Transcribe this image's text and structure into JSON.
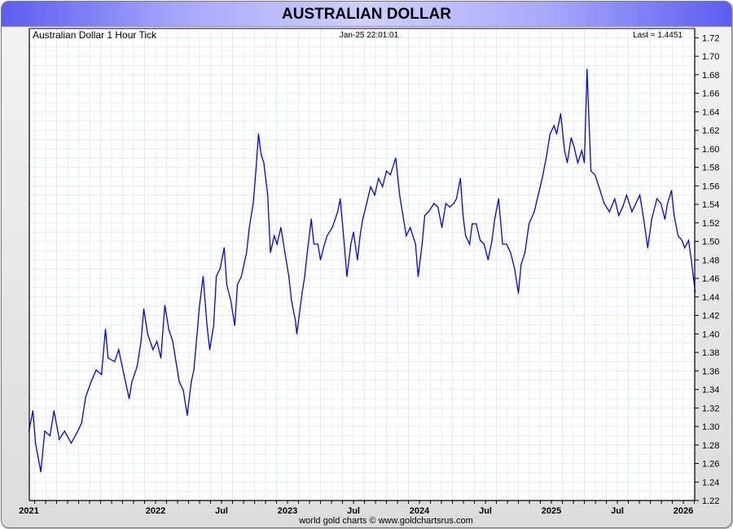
{
  "header": {
    "title": "AUSTRALIAN DOLLAR"
  },
  "chart_data": {
    "type": "line",
    "title": "Australian Dollar 1 Hour Tick",
    "timestamp": "Jan-25  22:01:01",
    "last_label": "Last = 1.4451",
    "footer": "world gold charts © www.goldchartsrus.com",
    "series_color": "#0000ff",
    "xlim": [
      2021.0,
      2026.1
    ],
    "ylim": [
      1.22,
      1.73
    ],
    "y_ticks": [
      "1.22",
      "1.24",
      "1.26",
      "1.28",
      "1.30",
      "1.32",
      "1.34",
      "1.36",
      "1.38",
      "1.40",
      "1.42",
      "1.44",
      "1.46",
      "1.48",
      "1.50",
      "1.52",
      "1.54",
      "1.56",
      "1.58",
      "1.60",
      "1.62",
      "1.64",
      "1.66",
      "1.68",
      "1.70",
      "1.72"
    ],
    "x_ticks": [
      {
        "label": "2021",
        "t": 2021.04
      },
      {
        "label": "2022",
        "t": 2022.0
      },
      {
        "label": "Jul",
        "t": 2022.5
      },
      {
        "label": "2023",
        "t": 2023.0
      },
      {
        "label": "Jul",
        "t": 2023.5
      },
      {
        "label": "2024",
        "t": 2024.0
      },
      {
        "label": "Jul",
        "t": 2024.5
      },
      {
        "label": "2025",
        "t": 2025.0
      },
      {
        "label": "Jul",
        "t": 2025.5
      },
      {
        "label": "2026",
        "t": 2026.0
      }
    ],
    "grid": true,
    "x": [
      2021.04,
      2021.07,
      2021.09,
      2021.13,
      2021.16,
      2021.2,
      2021.23,
      2021.27,
      2021.31,
      2021.36,
      2021.41,
      2021.44,
      2021.47,
      2021.51,
      2021.55,
      2021.59,
      2021.62,
      2021.64,
      2021.69,
      2021.72,
      2021.76,
      2021.8,
      2021.82,
      2021.86,
      2021.89,
      2021.91,
      2021.94,
      2021.98,
      2022.01,
      2022.04,
      2022.07,
      2022.1,
      2022.13,
      2022.15,
      2022.18,
      2022.21,
      2022.24,
      2022.27,
      2022.29,
      2022.32,
      2022.33,
      2022.36,
      2022.39,
      2022.41,
      2022.44,
      2022.46,
      2022.49,
      2022.52,
      2022.54,
      2022.57,
      2022.6,
      2022.62,
      2022.65,
      2022.69,
      2022.71,
      2022.74,
      2022.76,
      2022.78,
      2022.8,
      2022.82,
      2022.85,
      2022.87,
      2022.9,
      2022.92,
      2022.95,
      2022.98,
      2023.01,
      2023.03,
      2023.06,
      2023.07,
      2023.11,
      2023.13,
      2023.15,
      2023.18,
      2023.2,
      2023.23,
      2023.25,
      2023.28,
      2023.3,
      2023.34,
      2023.38,
      2023.4,
      2023.43,
      2023.45,
      2023.48,
      2023.5,
      2023.53,
      2023.55,
      2023.57,
      2023.6,
      2023.63,
      2023.66,
      2023.69,
      2023.72,
      2023.75,
      2023.78,
      2023.82,
      2023.85,
      2023.87,
      2023.9,
      2023.93,
      2023.97,
      2023.99,
      2024.02,
      2024.04,
      2024.07,
      2024.11,
      2024.14,
      2024.17,
      2024.2,
      2024.23,
      2024.26,
      2024.28,
      2024.31,
      2024.33,
      2024.35,
      2024.38,
      2024.4,
      2024.43,
      2024.46,
      2024.49,
      2024.52,
      2024.55,
      2024.57,
      2024.6,
      2024.63,
      2024.66,
      2024.69,
      2024.72,
      2024.75,
      2024.77,
      2024.8,
      2024.83,
      2024.87,
      2024.9,
      2024.93,
      2024.96,
      2024.99,
      2025.02,
      2025.04,
      2025.07,
      2025.1,
      2025.12,
      2025.15,
      2025.17,
      2025.2,
      2025.23,
      2025.25,
      2025.27,
      2025.28,
      2025.3,
      2025.33,
      2025.36,
      2025.4,
      2025.44,
      2025.48,
      2025.51,
      2025.54,
      2025.57,
      2025.61,
      2025.64,
      2025.67,
      2025.7,
      2025.73,
      2025.76,
      2025.8,
      2025.83,
      2025.86,
      2025.88,
      2025.91,
      2025.93,
      2025.96,
      2025.99,
      2026.01,
      2026.04,
      2026.06,
      2026.09
    ],
    "values": [
      1.295,
      1.317,
      1.282,
      1.251,
      1.295,
      1.29,
      1.317,
      1.286,
      1.295,
      1.282,
      1.295,
      1.304,
      1.332,
      1.348,
      1.361,
      1.356,
      1.405,
      1.374,
      1.37,
      1.383,
      1.356,
      1.33,
      1.348,
      1.365,
      1.392,
      1.427,
      1.4,
      1.383,
      1.392,
      1.374,
      1.431,
      1.405,
      1.392,
      1.374,
      1.348,
      1.339,
      1.312,
      1.348,
      1.361,
      1.409,
      1.427,
      1.462,
      1.409,
      1.383,
      1.409,
      1.462,
      1.471,
      1.493,
      1.453,
      1.436,
      1.409,
      1.453,
      1.462,
      1.488,
      1.515,
      1.541,
      1.576,
      1.616,
      1.594,
      1.585,
      1.55,
      1.488,
      1.506,
      1.497,
      1.515,
      1.488,
      1.462,
      1.436,
      1.414,
      1.4,
      1.444,
      1.462,
      1.488,
      1.524,
      1.497,
      1.497,
      1.48,
      1.497,
      1.506,
      1.515,
      1.532,
      1.546,
      1.497,
      1.462,
      1.497,
      1.51,
      1.48,
      1.506,
      1.524,
      1.541,
      1.559,
      1.55,
      1.568,
      1.559,
      1.576,
      1.572,
      1.59,
      1.55,
      1.532,
      1.506,
      1.515,
      1.497,
      1.462,
      1.497,
      1.528,
      1.532,
      1.541,
      1.537,
      1.515,
      1.541,
      1.537,
      1.541,
      1.546,
      1.568,
      1.528,
      1.506,
      1.497,
      1.519,
      1.519,
      1.501,
      1.497,
      1.48,
      1.501,
      1.524,
      1.546,
      1.497,
      1.497,
      1.488,
      1.471,
      1.444,
      1.475,
      1.488,
      1.519,
      1.532,
      1.55,
      1.568,
      1.59,
      1.616,
      1.625,
      1.616,
      1.638,
      1.598,
      1.585,
      1.612,
      1.603,
      1.585,
      1.598,
      1.585,
      1.686,
      1.647,
      1.576,
      1.572,
      1.559,
      1.541,
      1.532,
      1.546,
      1.528,
      1.537,
      1.55,
      1.532,
      1.541,
      1.55,
      1.524,
      1.493,
      1.524,
      1.546,
      1.541,
      1.524,
      1.541,
      1.555,
      1.528,
      1.506,
      1.501,
      1.493,
      1.501,
      1.48,
      1.445
    ]
  }
}
